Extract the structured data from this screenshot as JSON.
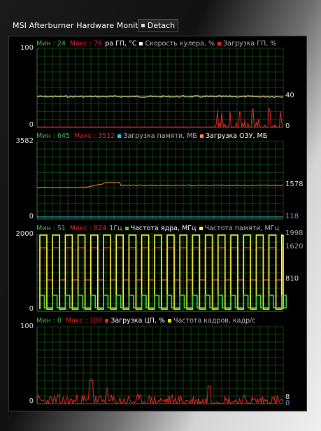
{
  "window": {
    "title": "MSI Afterburner Hardware Monitor",
    "detach_label": "Detach"
  },
  "colors": {
    "grid": "#0f4410",
    "min": "#3cc83c",
    "max": "#e62828"
  },
  "graphs": [
    {
      "stats": {
        "min": "Мин : 24",
        "max": "Макс : 76"
      },
      "legend": [
        {
          "text": "ра ГП, °С",
          "color": "#ffffff",
          "active": true,
          "marker": false
        },
        {
          "text": "Скорость кулера, %",
          "color": "#ffffff",
          "active": false,
          "marker": true
        },
        {
          "text": "Загрузка ГП, %",
          "color": "#e62828",
          "active": false,
          "marker": true
        }
      ],
      "ymax": "100",
      "ymin": "0",
      "right_labels": [
        {
          "text": "40",
          "color": "#e6e6e6"
        },
        {
          "text": "0",
          "color": "#e6e6e6"
        }
      ]
    },
    {
      "stats": {
        "min": "Мин : 645",
        "max": "Макс : 3512"
      },
      "legend": [
        {
          "text": "Загрузка памяти, МБ",
          "color": "#28c8e6",
          "active": false,
          "marker": true
        },
        {
          "text": "Загрузка ОЗУ, МБ",
          "color": "#ff8c32",
          "active": true,
          "marker": true
        }
      ],
      "ymax": "3582",
      "ymin": "0",
      "right_labels": [
        {
          "text": "1578",
          "color": "#e6e6e6"
        },
        {
          "text": "118",
          "color": "#6fa8c8"
        }
      ]
    },
    {
      "stats": {
        "min": "Мин : 51",
        "max": "Макс : 824"
      },
      "legend": [
        {
          "text": "1Гц",
          "color": "#ffffff",
          "active": false,
          "marker": false
        },
        {
          "text": "Частота ядра, МГц",
          "color": "#3cdc3c",
          "active": true,
          "marker": true
        },
        {
          "text": "Частота памяти, МГц",
          "color": "#ffff32",
          "active": false,
          "marker": true
        }
      ],
      "ymax": "2000",
      "ymin": "0",
      "right_labels": [
        {
          "text": "1998",
          "color": "#aaaaaa"
        },
        {
          "text": "1620",
          "color": "#aaaaaa"
        },
        {
          "text": "810",
          "color": "#e6e6e6"
        }
      ]
    },
    {
      "stats": {
        "min": "Мин : 0",
        "max": "Макс : 100"
      },
      "legend": [
        {
          "text": "Загрузка ЦП, %",
          "color": "#e62828",
          "active": true,
          "marker": true
        },
        {
          "text": "Частота кадров, кадр/с",
          "color": "#e6e600",
          "active": false,
          "marker": true
        }
      ],
      "ymax": "100",
      "ymin": "0",
      "right_labels": [
        {
          "text": "8",
          "color": "#e6e6e6"
        },
        {
          "text": "0",
          "color": "#6fa8c8"
        }
      ]
    }
  ]
}
